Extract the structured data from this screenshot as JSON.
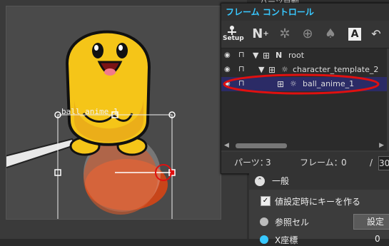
{
  "viewport": {
    "selected_object_label": "ball_anime_1"
  },
  "frame_panel": {
    "title": "フレーム コントロール",
    "toolbar": {
      "setup_label": "Setup",
      "buttons": [
        "setup-icon",
        "add-null-icon",
        "add-star-icon",
        "add-bone-icon",
        "add-pen-icon",
        "text-icon",
        "undo-text-icon"
      ]
    },
    "tree": [
      {
        "label": "root",
        "type": "null",
        "expanded": true
      },
      {
        "label": "character_template_2",
        "type": "sun",
        "expanded": true
      },
      {
        "label": "ball_anime_1",
        "type": "sun",
        "selected": true
      }
    ],
    "status": {
      "parts_label": "パーツ：",
      "parts_value": "3",
      "frame_label": "フレーム：",
      "frame_value": "0",
      "slash": "/",
      "total_value": "30"
    }
  },
  "right_strip": {
    "top_text": "パーツ自動"
  },
  "prop_panel": {
    "section_title": "一般",
    "checkbox_label": "値設定時にキーを作る",
    "checkbox_checked": true,
    "ref_cell_label": "参照セル",
    "set_button_label": "設定",
    "x_coord_label": "X座標",
    "x_coord_value": "0"
  },
  "colors": {
    "accent_blue": "#38c8ff",
    "selection_bg": "#2b2b66",
    "annotation_red": "#e01010",
    "character_yellow": "#f5c518",
    "ball_orange": "#d9531e"
  }
}
